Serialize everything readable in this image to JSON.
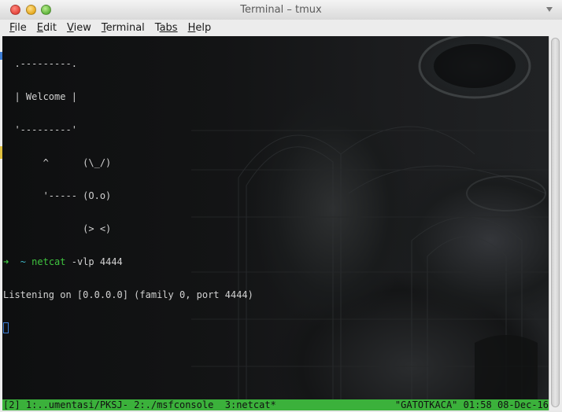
{
  "window": {
    "title": "Terminal – tmux",
    "buttons": {
      "close": "×",
      "minimize": "–",
      "maximize": "+"
    }
  },
  "menu": {
    "items": [
      {
        "label": "File",
        "mnemonic": "F",
        "rest": "ile"
      },
      {
        "label": "Edit",
        "mnemonic": "E",
        "rest": "dit"
      },
      {
        "label": "View",
        "mnemonic": "V",
        "rest": "iew"
      },
      {
        "label": "Terminal",
        "mnemonic": "T",
        "rest": "erminal"
      },
      {
        "label": "Tabs",
        "mnemonic": "T",
        "rest": "abs",
        "pre": ""
      },
      {
        "label": "Help",
        "mnemonic": "H",
        "rest": "elp"
      }
    ]
  },
  "terminal": {
    "banner": [
      "  .---------.",
      "  | Welcome |",
      "  '---------'",
      "       ^      (\\_/)",
      "       '----- (O.o)",
      "              (> <)"
    ],
    "prompt": {
      "arrow": "➜",
      "cwd": "~",
      "command": "netcat",
      "args": " -vlp 4444"
    },
    "output": "Listening on [0.0.0.0] (family 0, port 4444)"
  },
  "tmux": {
    "left": "[2] 1:..umentasi/PKSJ- 2:./msfconsole  3:netcat*",
    "right": "\"GATOTKACA\" 01:58 08-Dec-16"
  },
  "colors": {
    "status_green": "#3bb13b",
    "prompt_green": "#3fc33f",
    "prompt_cyan": "#3fb9c8",
    "cursor_blue": "#3f7fd6"
  }
}
